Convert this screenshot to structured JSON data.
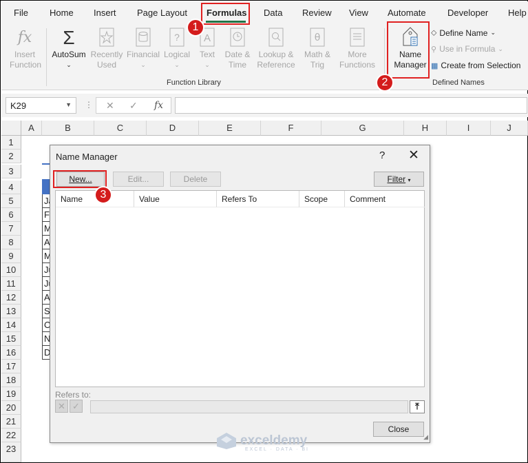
{
  "tabs": [
    "File",
    "Home",
    "Insert",
    "Page Layout",
    "Formulas",
    "Data",
    "Review",
    "View",
    "Automate",
    "Developer",
    "Help"
  ],
  "active_tab": "Formulas",
  "function_library": {
    "insert_function": "Insert Function",
    "autosum": "AutoSum",
    "recently_used": "Recently Used",
    "financial": "Financial",
    "logical": "Logical",
    "text": "Text",
    "date_time": "Date & Time",
    "lookup_reference": "Lookup & Reference",
    "math_trig": "Math & Trig",
    "more_functions": "More Functions",
    "group_label": "Function Library"
  },
  "defined_names": {
    "name_manager": "Name Manager",
    "define_name": "Define Name",
    "use_in_formula": "Use in Formula",
    "create_from_selection": "Create from Selection",
    "group_label": "Defined Names"
  },
  "formula_bar": {
    "name_box": "K29",
    "formula": ""
  },
  "columns": [
    "A",
    "B",
    "C",
    "D",
    "E",
    "F",
    "G",
    "H",
    "I",
    "J"
  ],
  "rows": [
    "1",
    "2",
    "3",
    "4",
    "5",
    "6",
    "7",
    "8",
    "9",
    "10",
    "11",
    "12",
    "13",
    "14",
    "15",
    "16",
    "17",
    "18",
    "19",
    "20",
    "21",
    "22",
    "23"
  ],
  "visible_cells": [
    "Ja",
    "Fe",
    "M",
    "A",
    "M",
    "Ju",
    "Ju",
    "A",
    "Se",
    "O",
    "N",
    "D"
  ],
  "dialog": {
    "title": "Name Manager",
    "help": "?",
    "close": "✕",
    "new_button": "New...",
    "edit_button": "Edit...",
    "delete_button": "Delete",
    "filter_button": "Filter",
    "columns": [
      "Name",
      "Value",
      "Refers To",
      "Scope",
      "Comment"
    ],
    "refers_to_label": "Refers to:",
    "close_button": "Close"
  },
  "annotations": [
    "1",
    "2",
    "3"
  ],
  "watermark": {
    "name": "exceldemy",
    "sub": "EXCEL · DATA · BI"
  },
  "colors": {
    "excel_green": "#217346",
    "highlight_red": "#e02020",
    "header_blue": "#4472c4"
  }
}
